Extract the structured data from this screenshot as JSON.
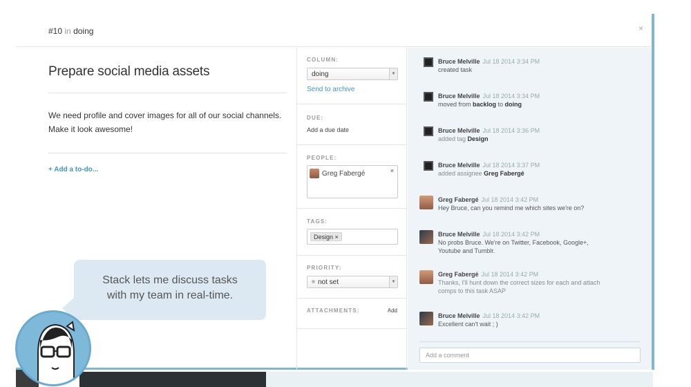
{
  "header": {
    "task_number": "#10",
    "in_word": "in",
    "column_name": "doing",
    "close_glyph": "×"
  },
  "task": {
    "title": "Prepare social media assets",
    "description_line1": "We need profile and cover images for all of our social channels.",
    "description_line2": "Make it look awesome!",
    "add_todo_label": "+ Add a to-do..."
  },
  "meta": {
    "column_label": "COLUMN:",
    "column_value": "doing",
    "send_to_archive": "Send to archive",
    "due_label": "DUE:",
    "add_due_date": "Add a due date",
    "people_label": "PEOPLE:",
    "person_name": "Greg Fabergé",
    "person_remove": "×",
    "tags_label": "TAGS:",
    "tag_value": "Design",
    "tag_remove": "×",
    "priority_label": "PRIORITY:",
    "priority_value": "not set",
    "attachments_label": "ATTACHMENTS:",
    "attachments_add": "Add",
    "caret_glyph": "▼"
  },
  "activity": [
    {
      "name": "Bruce Melville",
      "time": "Jul 18 2014 3:34 PM",
      "pre": "created task",
      "bold": "",
      "mid": "",
      "bold2": "",
      "avatar": "bruce-icon"
    },
    {
      "name": "Bruce Melville",
      "time": "Jul 18 2014 3:34 PM",
      "pre": "moved from ",
      "bold": "backlog",
      "mid": " to ",
      "bold2": "doing",
      "avatar": "bruce-icon"
    },
    {
      "name": "Bruce Melville",
      "time": "Jul 18 2014 3:36 PM",
      "pre": "added tag ",
      "bold": "Design",
      "mid": "",
      "bold2": "",
      "avatar": "bruce-icon"
    },
    {
      "name": "Bruce Melville",
      "time": "Jul 18 2014 3:37 PM",
      "pre": "added assignee ",
      "bold": "Greg Fabergé",
      "mid": "",
      "bold2": "",
      "avatar": "bruce-icon"
    },
    {
      "name": "Greg Fabergé",
      "time": "Jul 18 2014 3:42 PM",
      "pre": "Hey Bruce, can you remind me which sites we're on?",
      "bold": "",
      "mid": "",
      "bold2": "",
      "avatar": "greg-photo"
    },
    {
      "name": "Bruce Melville",
      "time": "Jul 18 2014 3:42 PM",
      "pre": "No probs Bruce. We're on Twitter, Facebook, Google+, Youtube and Tumblr.",
      "bold": "",
      "mid": "",
      "bold2": "",
      "avatar": "bruce-photo"
    },
    {
      "name": "Greg Fabergé",
      "time": "Jul 18 2014 3:42 PM",
      "pre": "Thanks, I'll hunt down the correct sizes for each and attach comps to this task ASAP",
      "bold": "",
      "mid": "",
      "bold2": "",
      "avatar": "greg-photo"
    },
    {
      "name": "Bruce Melville",
      "time": "Jul 18 2014 3:42 PM",
      "pre": "Excellent can't wait ; )",
      "bold": "",
      "mid": "",
      "bold2": "",
      "avatar": "bruce-photo"
    }
  ],
  "comment": {
    "placeholder": "Add a comment"
  },
  "bubble": {
    "line1": "Stack lets me discuss tasks",
    "line2": "with my team in real-time."
  },
  "colors": {
    "accent_blue": "#3f95cc",
    "modal_border": "#7fb6d4",
    "activity_bg": "#eef4f8",
    "bubble_bg": "#dde9f2"
  }
}
